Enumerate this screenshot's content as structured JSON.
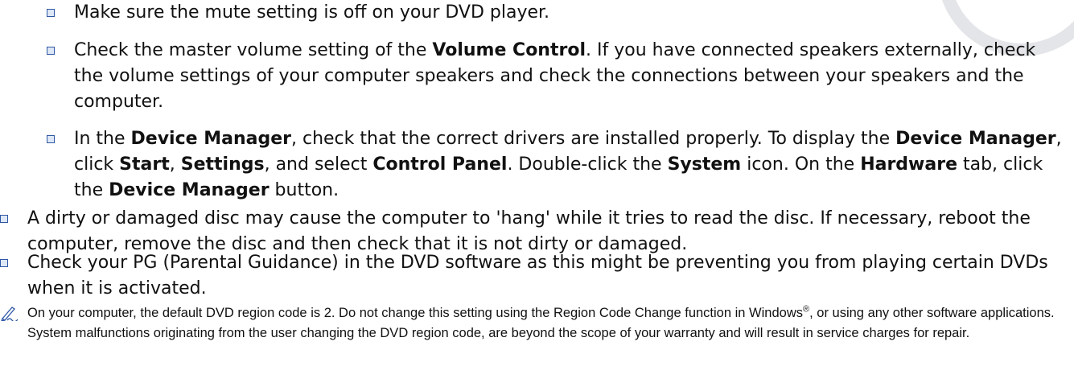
{
  "items": [
    {
      "text": "Make sure the mute setting is off on your DVD player."
    },
    {
      "p1": "Check the master volume setting of the ",
      "b1": "Volume Control",
      "p2": ". If you have connected speakers externally, check the volume settings of your computer speakers and check the connections between your speakers and the computer."
    },
    {
      "p1": "In the ",
      "b1": "Device Manager",
      "p2": ", check that the correct drivers are installed properly. To display the ",
      "b2": "Device Manager",
      "p3": ", click ",
      "b3": "Start",
      "p4": ", ",
      "b4": "Settings",
      "p5": ", and select ",
      "b5": "Control Panel",
      "p6": ". Double-click the ",
      "b6": "System",
      "p7": " icon. On the ",
      "b7": "Hardware",
      "p8": " tab, click the ",
      "b8": "Device Manager",
      "p9": " button."
    },
    {
      "text": "A dirty or damaged disc may cause the computer to 'hang' while it tries to read the disc. If necessary, reboot the computer, remove the disc and then check that it is not dirty or damaged."
    },
    {
      "text": "Check your PG (Parental Guidance) in the DVD software as this might be preventing you from playing certain DVDs when it is activated."
    }
  ],
  "note": {
    "icon": "note-pencil-icon",
    "p1": "On your computer, the default DVD region code is 2. Do not change this setting using the Region Code Change function in Windows",
    "reg": "®",
    "p2": ", or using any other software applications. System malfunctions originating from the user changing the DVD region code, are beyond the scope of your warranty and will result in service charges for repair."
  }
}
